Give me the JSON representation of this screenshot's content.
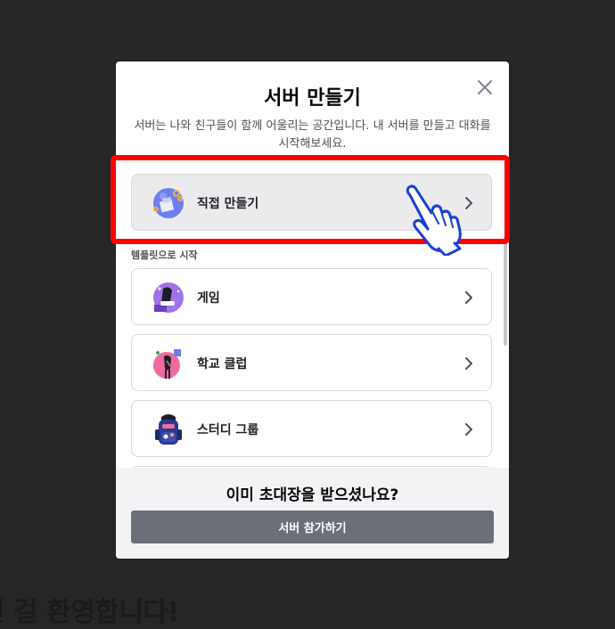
{
  "background": {
    "welcome_text": "인 걸 환영합니다!"
  },
  "modal": {
    "title": "서버 만들기",
    "subtitle": "서버는 나와 친구들이 함께 어울리는 공간입니다. 내 서버를 만들고 대화를 시작해보세요.",
    "close_icon": "close-icon",
    "primary_option": {
      "label": "직접 만들기",
      "icon": "create-own-server-icon"
    },
    "template_section_label": "템플릿으로 시작",
    "templates": [
      {
        "label": "게임",
        "icon": "gaming-icon"
      },
      {
        "label": "학교 클럽",
        "icon": "school-club-icon"
      },
      {
        "label": "스터디 그룹",
        "icon": "study-group-icon"
      }
    ],
    "footer": {
      "title": "이미 초대장을 받으셨나요?",
      "join_button_label": "서버 참가하기"
    }
  },
  "colors": {
    "highlight": "#ff0000",
    "pointer": "#1a3fd6",
    "join_button": "#6d6f78"
  }
}
